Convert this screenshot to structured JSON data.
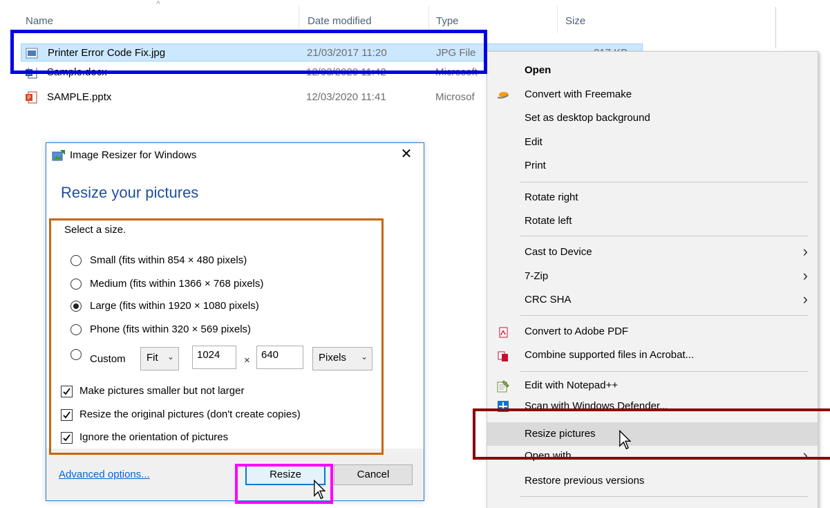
{
  "explorer": {
    "columns": {
      "name": "Name",
      "date": "Date modified",
      "type": "Type",
      "size": "Size"
    },
    "files": [
      {
        "name": "Printer Error Code Fix.jpg",
        "date": "21/03/2017 11:20",
        "type": "JPG File",
        "size": "217 KB",
        "icon": "image-file-icon",
        "selected": true
      },
      {
        "name": "Sample.docx",
        "date": "12/03/2020 11:42",
        "type": "Microsoft",
        "size": "",
        "icon": "word-file-icon",
        "selected": false
      },
      {
        "name": "SAMPLE.pptx",
        "date": "12/03/2020 11:41",
        "type": "Microsof",
        "size": "",
        "icon": "powerpoint-file-icon",
        "selected": false
      }
    ]
  },
  "dialog": {
    "title": "Image Resizer for Windows",
    "close_glyph": "✕",
    "heading": "Resize your pictures",
    "select_label": "Select a size.",
    "sizes": [
      {
        "label": "Small (fits within 854 × 480 pixels)",
        "checked": false
      },
      {
        "label": "Medium (fits within 1366 × 768 pixels)",
        "checked": false
      },
      {
        "label": "Large (fits within 1920 × 1080 pixels)",
        "checked": true
      },
      {
        "label": "Phone (fits within 320 × 569 pixels)",
        "checked": false
      }
    ],
    "custom": {
      "label": "Custom",
      "checked": false,
      "fit_value": "Fit",
      "width": "1024",
      "times": "×",
      "height": "640",
      "unit_value": "Pixels"
    },
    "options": [
      {
        "label": "Make pictures smaller but not larger",
        "checked": true
      },
      {
        "label": "Resize the original pictures (don't create copies)",
        "checked": true
      },
      {
        "label": "Ignore the orientation of pictures",
        "checked": true
      }
    ],
    "advanced_link": "Advanced options...",
    "resize_button": "Resize",
    "cancel_button": "Cancel"
  },
  "context_menu": {
    "items": [
      {
        "label": "Open",
        "bold": true
      },
      {
        "label": "Convert with Freemake",
        "icon": "freemake-icon"
      },
      {
        "label": "Set as desktop background"
      },
      {
        "label": "Edit"
      },
      {
        "label": "Print"
      },
      {
        "label": "Rotate right"
      },
      {
        "label": "Rotate left"
      },
      {
        "label": "Cast to Device",
        "submenu": true
      },
      {
        "label": "7-Zip",
        "submenu": true
      },
      {
        "label": "CRC SHA",
        "submenu": true
      },
      {
        "label": "Convert to Adobe PDF",
        "icon": "adobe-pdf-icon"
      },
      {
        "label": "Combine supported files in Acrobat...",
        "icon": "acrobat-combine-icon"
      },
      {
        "label": "Edit with Notepad++",
        "icon": "notepad-plus-plus-icon"
      },
      {
        "label": "Scan with Windows Defender...",
        "icon": "windows-defender-icon"
      },
      {
        "label": "Resize pictures",
        "hover": true
      },
      {
        "label": "Open with",
        "submenu": true
      },
      {
        "label": "Restore previous versions"
      }
    ],
    "submenu_glyph": "›"
  },
  "annotations": {
    "colors": {
      "blue": "#0000e6",
      "orange": "#c8650a",
      "magenta": "#ff00ff",
      "darkred": "#8b0000"
    }
  }
}
